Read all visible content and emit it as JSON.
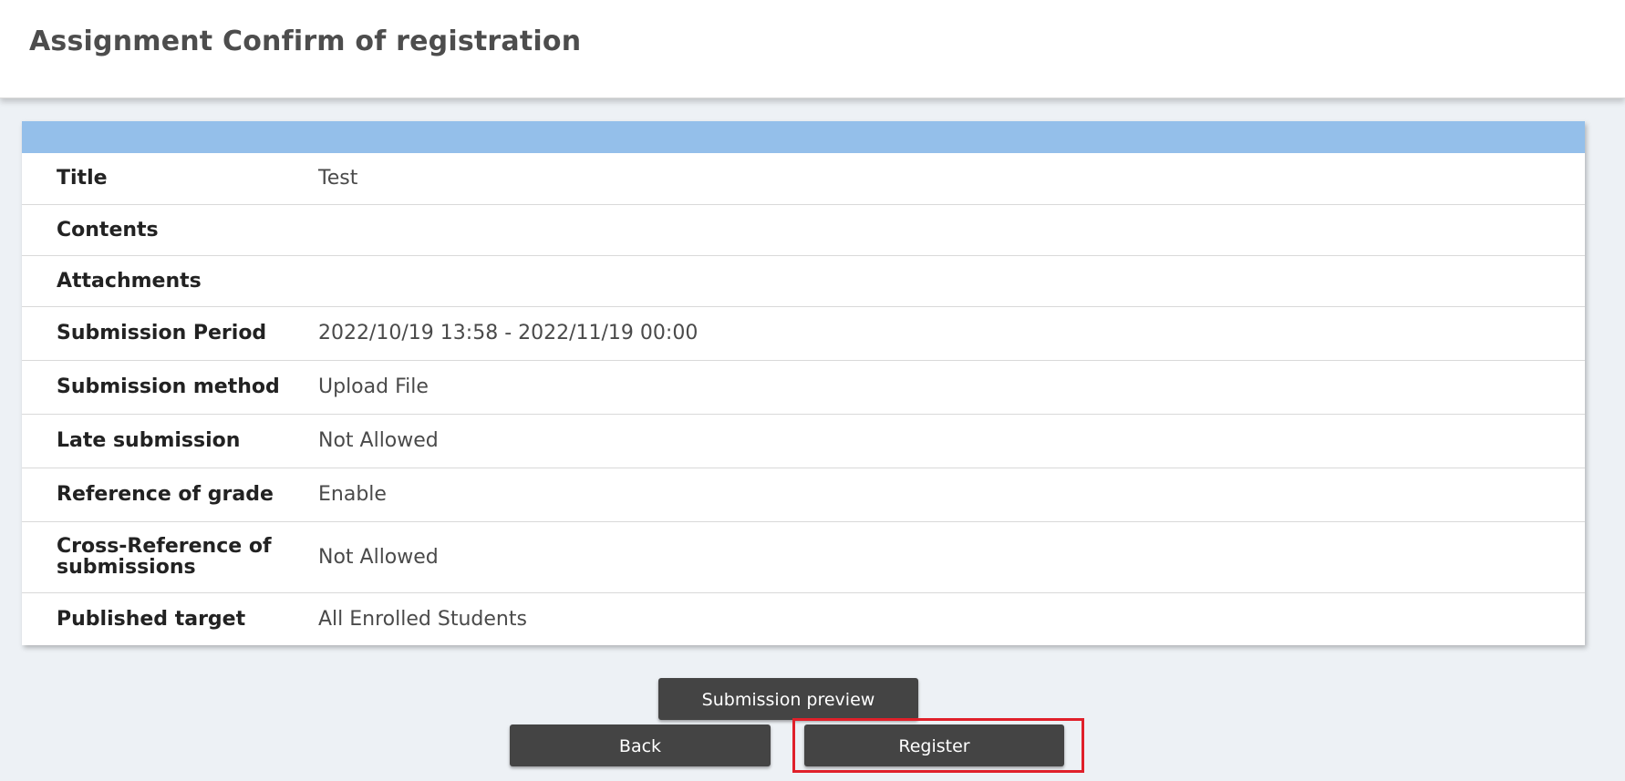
{
  "header": {
    "title": "Assignment Confirm of registration"
  },
  "details": [
    {
      "label": "Title",
      "value": "Test"
    },
    {
      "label": "Contents",
      "value": ""
    },
    {
      "label": "Attachments",
      "value": ""
    },
    {
      "label": "Submission Period",
      "value": "2022/10/19 13:58 - 2022/11/19 00:00"
    },
    {
      "label": "Submission method",
      "value": "Upload File"
    },
    {
      "label": "Late submission",
      "value": "Not Allowed"
    },
    {
      "label": "Reference of grade",
      "value": "Enable"
    },
    {
      "label": "Cross-Reference of submissions",
      "value": "Not Allowed"
    },
    {
      "label": "Published target",
      "value": "All Enrolled Students"
    }
  ],
  "actions": {
    "preview_label": "Submission preview",
    "back_label": "Back",
    "register_label": "Register"
  },
  "colors": {
    "panel_bar": "#94bfea",
    "button_bg": "#444444",
    "highlight_border": "#e0202a",
    "page_bg": "#edf1f5"
  }
}
